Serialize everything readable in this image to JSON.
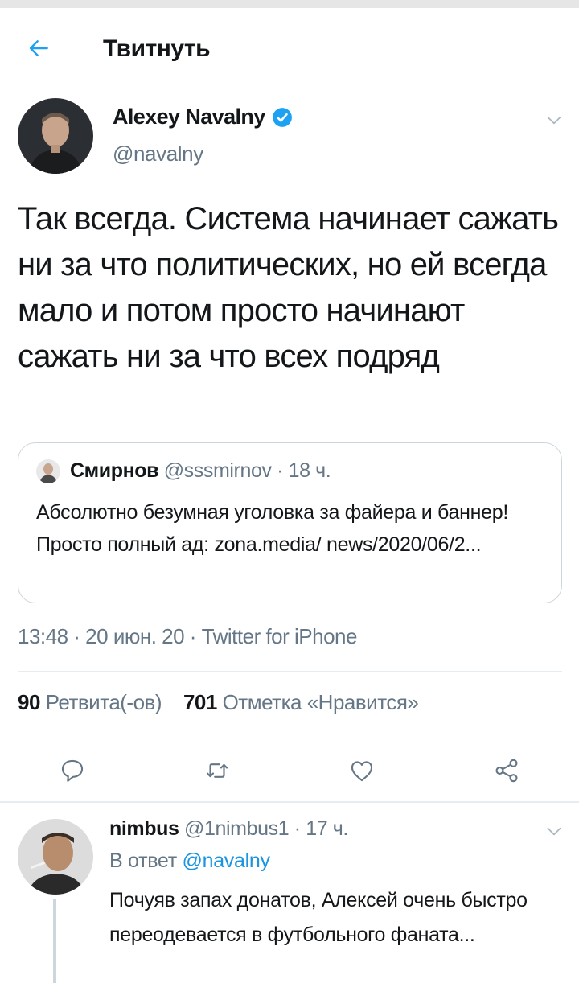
{
  "header": {
    "title": "Твитнуть"
  },
  "tweet": {
    "author_name": "Alexey Navalny",
    "author_handle": "@navalny",
    "verified": true,
    "text": "Так всегда. Система начинает сажать ни за что политических, но ей всегда мало и потом просто начинают сажать ни за что всех подряд",
    "quote": {
      "name": "Смирнов",
      "meta": "@sssmirnov · 18 ч.",
      "text": "Абсолютно безумная уголовка за файера и баннер! Просто полный ад: zona.media/ news/2020/06/2..."
    },
    "meta": "13:48 · 20 июн. 20 · Twitter for iPhone",
    "stats": {
      "retweets_count": "90",
      "retweets_label": "Ретвита(-ов)",
      "likes_count": "701",
      "likes_label": "Отметка «Нравится»"
    }
  },
  "reply": {
    "name": "nimbus",
    "meta": "@1nimbus1 · 17 ч.",
    "reply_prefix": "В ответ",
    "reply_mention": "@navalny",
    "text": "Почуяв запах донатов, Алексей очень быстро переодевается в футбольного фаната..."
  },
  "icons": {
    "back": "arrow-left-icon",
    "verified": "verified-badge-icon",
    "chevron": "chevron-down-icon",
    "reply": "reply-icon",
    "retweet": "retweet-icon",
    "like": "heart-icon",
    "share": "share-icon"
  },
  "colors": {
    "accent": "#1da1f2",
    "mention": "#1b95e0",
    "secondary_text": "#657786",
    "border": "#e6ecf0"
  }
}
